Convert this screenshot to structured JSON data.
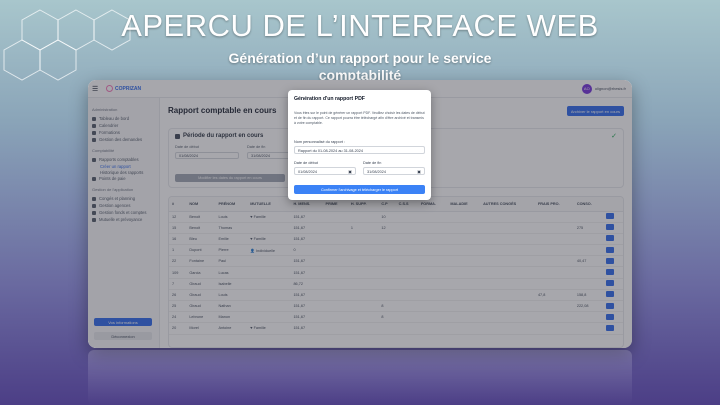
{
  "slide": {
    "title": "APERCU DE L’INTERFACE WEB",
    "subtitle": "Génération d’un rapport pour le service comptabilité"
  },
  "topbar": {
    "app_name": "COPRIZAN",
    "user_email": "olignon@rhesis.fr",
    "avatar_initials": "AO"
  },
  "sidebar": {
    "sections": [
      {
        "title": "Administration",
        "items": [
          "Tableau de bord",
          "Calendrier",
          "Formations",
          "Gestion des demandes"
        ]
      },
      {
        "title": "Comptabilité",
        "items": [
          "Rapports comptables",
          "Historique des rapports",
          "Points de paie"
        ]
      },
      {
        "title": "Gestion de l'application",
        "items": [
          "Congés et planning",
          "Gestion agences",
          "Gestion fonds et comptes",
          "Mutuelle et prévoyance"
        ]
      }
    ],
    "active_sub": "Créer un rapport",
    "bottom_primary": "Vos informations",
    "bottom_secondary": "Déconnexion"
  },
  "main": {
    "page_title": "Rapport comptable en cours",
    "action_button": "Archiver le rapport en cours",
    "period_card": {
      "title": "Période du rapport en cours",
      "start_label": "Date de début",
      "start_value": "01/08/2024",
      "end_label": "Date de fin",
      "end_value": "31/08/2024",
      "modify_button": "Modifier les dates du rapport en cours"
    },
    "table": {
      "headers": [
        "#",
        "NOM",
        "PRÉNOM",
        "MUTUELLE",
        "H. MENS.",
        "PRIME",
        "H. SUPP.",
        "C.P",
        "C.S.S",
        "FORMA.",
        "MALADIE",
        "AUTRES CONGÉS",
        "FRAIS PRO.",
        "CONSO."
      ],
      "rows": [
        [
          "12",
          "Benoit",
          "Louis",
          "Famille",
          "151,67",
          "",
          "",
          "10",
          "",
          "",
          "",
          "",
          "",
          ""
        ],
        [
          "15",
          "Benoit",
          "Thomas",
          "",
          "151,67",
          "",
          "1",
          "12",
          "",
          "",
          "",
          "",
          "",
          "275"
        ],
        [
          "16",
          "Bleu",
          "Emilie",
          "Famille",
          "151,67",
          "",
          "",
          "",
          "",
          "",
          "",
          "",
          "",
          ""
        ],
        [
          "1",
          "Dupont",
          "Pierre",
          "Individuelle",
          "0",
          "",
          "",
          "",
          "",
          "",
          "",
          "",
          "",
          ""
        ],
        [
          "22",
          "Fontaine",
          "Paul",
          "",
          "151,67",
          "",
          "",
          "",
          "",
          "",
          "",
          "",
          "",
          "40,47"
        ],
        [
          "109",
          "Garcia",
          "Lucas",
          "",
          "151,67",
          "",
          "",
          "",
          "",
          "",
          "",
          "",
          "",
          ""
        ],
        [
          "7",
          "Giraud",
          "Isabelle",
          "",
          "86,72",
          "",
          "",
          "",
          "",
          "",
          "",
          "",
          "",
          ""
        ],
        [
          "26",
          "Giraud",
          "Louis",
          "",
          "151,67",
          "",
          "",
          "",
          "",
          "",
          "",
          "",
          "47,8",
          "158,8"
        ],
        [
          "25",
          "Giraud",
          "Nathan",
          "",
          "151,67",
          "",
          "",
          "8",
          "",
          "",
          "",
          "",
          "",
          "222,08"
        ],
        [
          "24",
          "Lebrune",
          "Manon",
          "",
          "151,67",
          "",
          "",
          "8",
          "",
          "",
          "",
          "",
          "",
          ""
        ],
        [
          "20",
          "Morel",
          "Antoine",
          "Famille",
          "151,67",
          "",
          "",
          "",
          "",
          "",
          "",
          "",
          "",
          ""
        ]
      ]
    }
  },
  "modal": {
    "title": "Génération d'un rapport PDF",
    "description": "Vous êtes sur le point de générer un rapport PDF. Veuillez choisir les dates de début et de fin du rapport. Ce rapport pourra être téléchargé afin d'être archivé et transmis à votre comptable.",
    "name_label": "Nom personnalisé du rapport :",
    "name_value": "Rapport du 01-08-2024 au 31-08-2024",
    "start_label": "Date de début",
    "start_value": "01/08/2024",
    "end_label": "Date de fin",
    "end_value": "31/08/2024",
    "confirm_button": "Confirmer l'archivage et télécharger le rapport"
  }
}
